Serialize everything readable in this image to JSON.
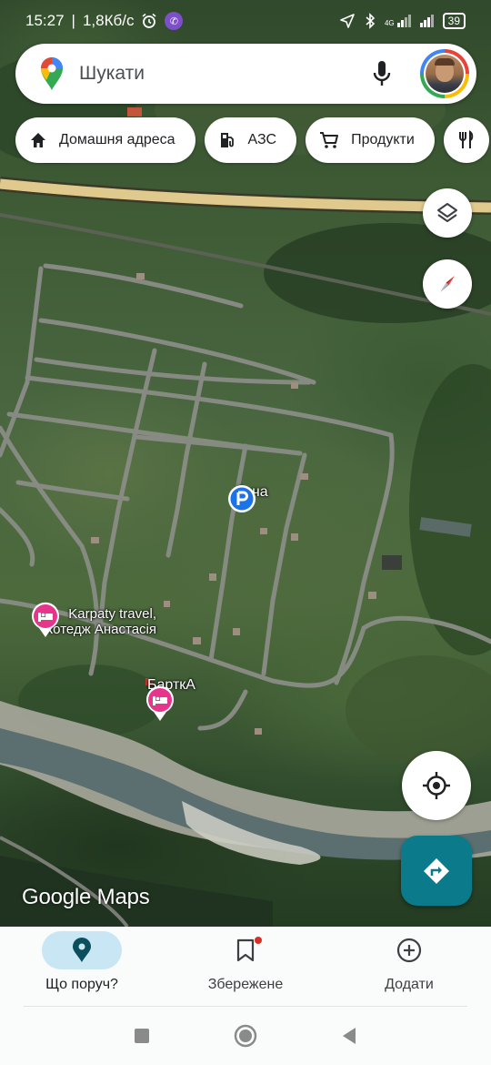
{
  "status_bar": {
    "time": "15:27",
    "network_speed": "1,8Кб/с",
    "battery": "39",
    "network_type": "4G"
  },
  "search": {
    "placeholder": "Шукати"
  },
  "chips": [
    {
      "label": "Домашня адреса",
      "icon": "home-icon"
    },
    {
      "label": "АЗС",
      "icon": "fuel-icon"
    },
    {
      "label": "Продукти",
      "icon": "cart-icon"
    },
    {
      "label": "",
      "icon": "restaurant-icon"
    }
  ],
  "map": {
    "places": [
      {
        "name": "Дача",
        "type": "parking",
        "color": "#1a73e8"
      },
      {
        "name": "Karpaty travel,\nКотедж Анастасія",
        "type": "hotel",
        "color": "#e5368b"
      },
      {
        "name": "БарткА",
        "type": "hotel",
        "color": "#e5368b"
      }
    ],
    "attribution": "Google Maps"
  },
  "bottom_nav": {
    "items": [
      {
        "label": "Що поруч?",
        "icon": "location-pin-icon",
        "active": true
      },
      {
        "label": "Збережене",
        "icon": "bookmark-icon",
        "active": false
      },
      {
        "label": "Додати",
        "icon": "add-circle-icon",
        "active": false
      }
    ]
  },
  "colors": {
    "accent_teal": "#0b7a8a",
    "active_nav_bg": "#c8e6f3",
    "hotel_pin": "#e5368b",
    "parking_pin": "#1a73e8"
  }
}
